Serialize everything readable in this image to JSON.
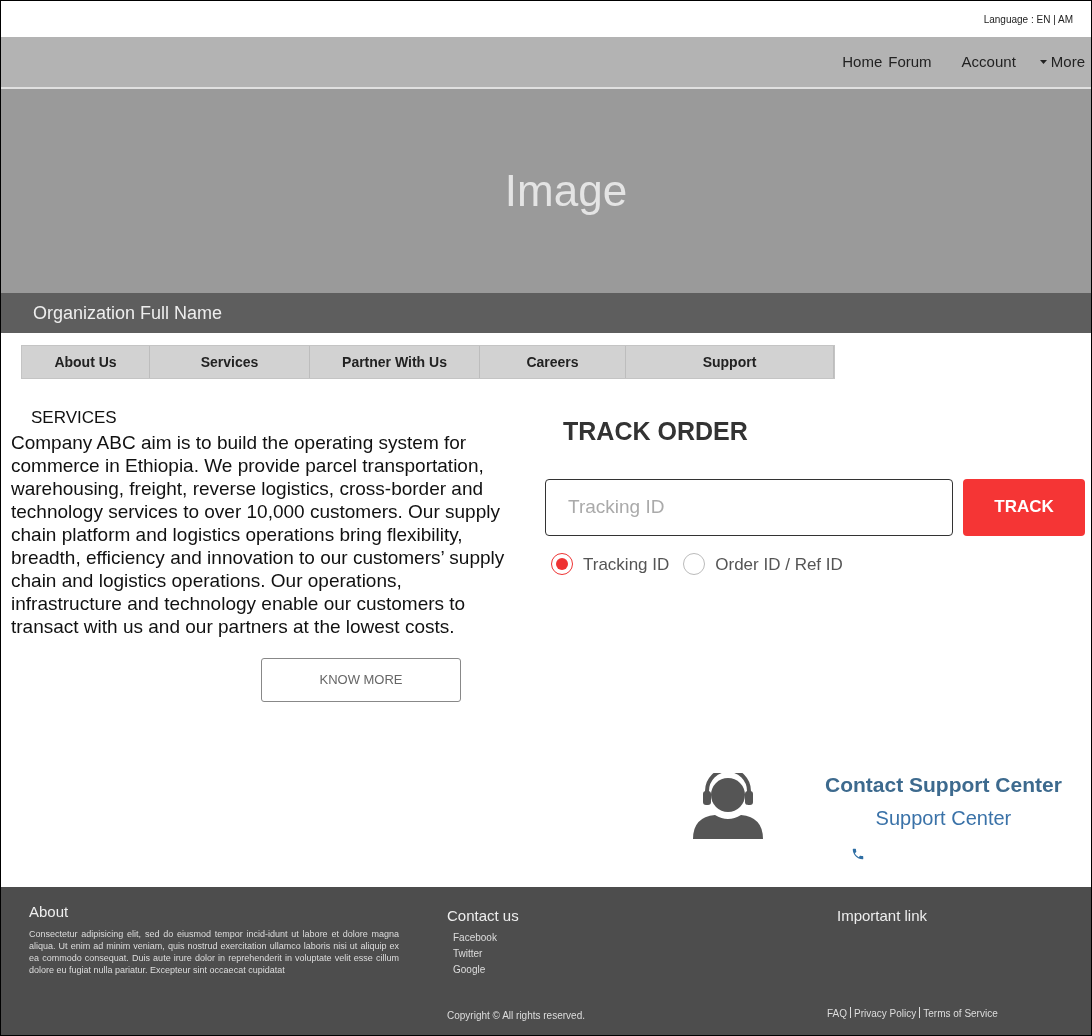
{
  "language_bar": {
    "label": "Language : EN | AM"
  },
  "nav": {
    "items": [
      {
        "label": "Home"
      },
      {
        "label": "Forum"
      },
      {
        "label": "Account"
      },
      {
        "label": "More",
        "kind": "dropdown"
      }
    ]
  },
  "banner": {
    "text": "Image"
  },
  "organization": {
    "name": "Organization Full Name"
  },
  "tabs": [
    {
      "label": "About Us"
    },
    {
      "label": "Services"
    },
    {
      "label": "Partner With Us"
    },
    {
      "label": "Careers"
    },
    {
      "label": "Support"
    }
  ],
  "services": {
    "heading": "SERVICES",
    "body": "Company ABC aim is to build the operating system for commerce in Ethiopia. We provide parcel transportation, warehousing, freight, reverse logistics, cross-border and technology services to over 10,000 customers. Our supply chain platform and logistics operations bring flexibility, breadth, efficiency and innovation to our customers’ supply chain and logistics operations. Our operations, infrastructure and technology enable our customers to transact with us and our partners at the lowest costs.",
    "button": "KNOW MORE"
  },
  "track_order": {
    "title": "TRACK ORDER",
    "placeholder": "Tracking ID",
    "button": "TRACK",
    "options": [
      {
        "label": "Tracking ID",
        "selected": true
      },
      {
        "label": "Order ID / Ref ID",
        "selected": false
      }
    ]
  },
  "support": {
    "title": "Contact Support Center",
    "subtitle": "Support Center"
  },
  "footer": {
    "about": {
      "heading": "About",
      "text": "Consectetur adipisicing elit, sed do eiusmod tempor incid-idunt ut labore et dolore magna aliqua. Ut enim ad minim veniam, quis nostrud exercitation ullamco laboris nisi ut aliquip ex ea commodo consequat. Duis aute irure dolor in reprehenderit in voluptate velit esse cillum dolore eu fugiat nulla pariatur. Excepteur sint occaecat cupidatat"
    },
    "contact": {
      "heading": "Contact us",
      "links": [
        "Facebook",
        "Twitter",
        "Google"
      ],
      "copyright": "Copyright © All rights reserved."
    },
    "important": {
      "heading": "Important link",
      "links": [
        "FAQ",
        "Privacy Policy",
        "Terms of Service"
      ]
    }
  }
}
